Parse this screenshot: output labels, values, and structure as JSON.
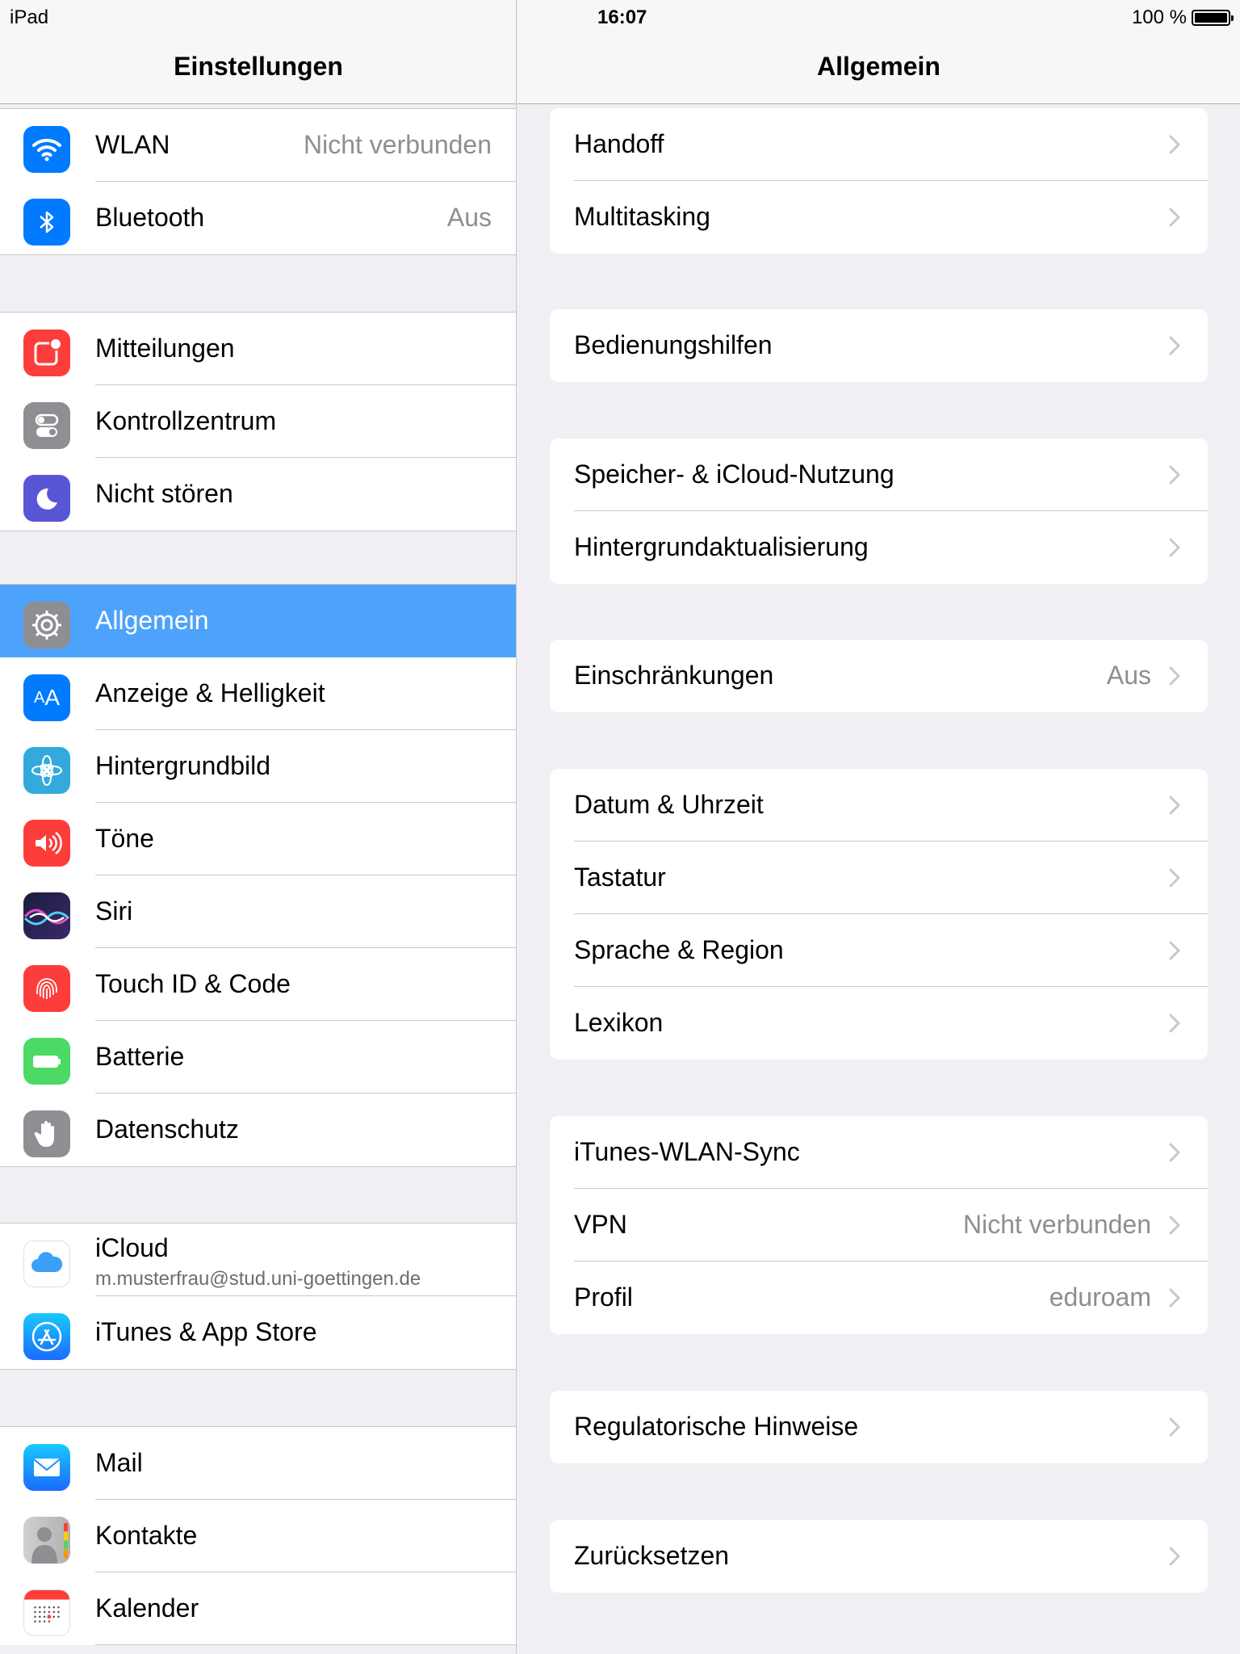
{
  "status": {
    "device": "iPad",
    "time": "16:07",
    "battery": "100 %",
    "battery_level": 1.0
  },
  "master": {
    "title": "Einstellungen",
    "groups": [
      [
        {
          "label": "WLAN",
          "value": "Nicht verbunden",
          "icon": "wifi-icon",
          "color": "#007aff"
        },
        {
          "label": "Bluetooth",
          "value": "Aus",
          "icon": "bluetooth-icon",
          "color": "#007aff"
        }
      ],
      [
        {
          "label": "Mitteilungen",
          "icon": "notifications-icon",
          "color": "#fc3d39"
        },
        {
          "label": "Kontrollzentrum",
          "icon": "control-center-icon",
          "color": "#8e8e93"
        },
        {
          "label": "Nicht stören",
          "icon": "moon-icon",
          "color": "#5856d6"
        }
      ],
      [
        {
          "label": "Allgemein",
          "icon": "gear-icon",
          "color": "#8e8e93",
          "selected": true
        },
        {
          "label": "Anzeige & Helligkeit",
          "icon": "text-size-icon",
          "color": "#007aff"
        },
        {
          "label": "Hintergrundbild",
          "icon": "flower-icon",
          "color": "#34aadc"
        },
        {
          "label": "Töne",
          "icon": "speaker-icon",
          "color": "#fc3d39"
        },
        {
          "label": "Siri",
          "icon": "siri-icon",
          "color": "#1c1c3c"
        },
        {
          "label": "Touch ID & Code",
          "icon": "fingerprint-icon",
          "color": "#fc3d39"
        },
        {
          "label": "Batterie",
          "icon": "battery-icon",
          "color": "#4cd964"
        },
        {
          "label": "Datenschutz",
          "icon": "hand-icon",
          "color": "#8e8e93"
        }
      ],
      [
        {
          "label": "iCloud",
          "sublabel": "m.musterfrau@stud.uni-goettingen.de",
          "icon": "cloud-icon",
          "color": "#ffffff"
        },
        {
          "label": "iTunes & App Store",
          "icon": "app-store-icon",
          "color": "#1a8cff"
        }
      ],
      [
        {
          "label": "Mail",
          "icon": "mail-icon",
          "color": "#1a8cff"
        },
        {
          "label": "Kontakte",
          "icon": "contacts-icon",
          "color": "#b7b7b7"
        },
        {
          "label": "Kalender",
          "icon": "calendar-icon",
          "color": "#ffffff"
        }
      ]
    ]
  },
  "detail": {
    "title": "Allgemein",
    "groups": [
      [
        {
          "label": "Handoff"
        },
        {
          "label": "Multitasking"
        }
      ],
      [
        {
          "label": "Bedienungshilfen"
        }
      ],
      [
        {
          "label": "Speicher- & iCloud-Nutzung"
        },
        {
          "label": "Hintergrundaktualisierung"
        }
      ],
      [
        {
          "label": "Einschränkungen",
          "value": "Aus"
        }
      ],
      [
        {
          "label": "Datum & Uhrzeit"
        },
        {
          "label": "Tastatur"
        },
        {
          "label": "Sprache & Region"
        },
        {
          "label": "Lexikon"
        }
      ],
      [
        {
          "label": "iTunes-WLAN-Sync"
        },
        {
          "label": "VPN",
          "value": "Nicht verbunden"
        },
        {
          "label": "Profil",
          "value": "eduroam"
        }
      ],
      [
        {
          "label": "Regulatorische Hinweise"
        }
      ],
      [
        {
          "label": "Zurücksetzen"
        }
      ]
    ]
  }
}
